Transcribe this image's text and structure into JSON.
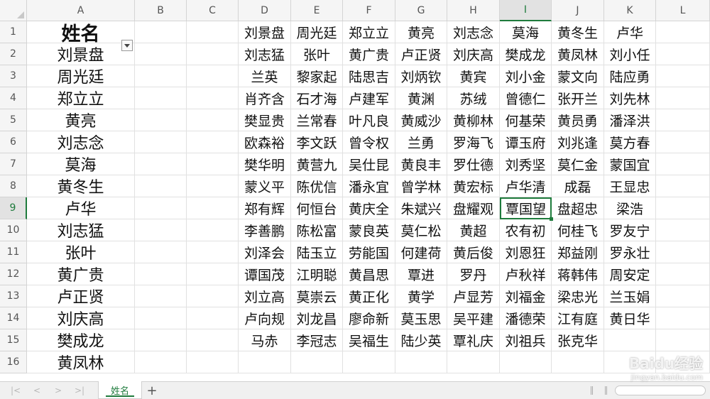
{
  "columns": [
    "A",
    "B",
    "C",
    "D",
    "E",
    "F",
    "G",
    "H",
    "I",
    "J",
    "K",
    "L"
  ],
  "rows": [
    "1",
    "2",
    "3",
    "4",
    "5",
    "6",
    "7",
    "8",
    "9",
    "10",
    "11",
    "12",
    "13",
    "14",
    "15",
    "16"
  ],
  "active_cell": "I9",
  "colA": [
    "姓名",
    "刘景盘",
    "周光廷",
    "郑立立",
    "黄亮",
    "刘志念",
    "莫海",
    "黄冬生",
    "卢华",
    "刘志猛",
    "张叶",
    "黄广贵",
    "卢正贤",
    "刘庆高",
    "樊成龙",
    "黄凤林"
  ],
  "grid": [
    [
      "刘景盘",
      "周光廷",
      "郑立立",
      "黄亮",
      "刘志念",
      "莫海",
      "黄冬生",
      "卢华"
    ],
    [
      "刘志猛",
      "张叶",
      "黄广贵",
      "卢正贤",
      "刘庆高",
      "樊成龙",
      "黄凤林",
      "刘小任"
    ],
    [
      "兰英",
      "黎家起",
      "陆思吉",
      "刘炳钦",
      "黄宾",
      "刘小金",
      "蒙文向",
      "陆应勇"
    ],
    [
      "肖齐含",
      "石才海",
      "卢建军",
      "黄渊",
      "苏绒",
      "曾德仁",
      "张开兰",
      "刘先林"
    ],
    [
      "樊显贵",
      "兰常春",
      "叶凡良",
      "黄威沙",
      "黄柳林",
      "何基荣",
      "黄员勇",
      "潘泽洪"
    ],
    [
      "欧森裕",
      "李文跃",
      "曾令权",
      "兰勇",
      "罗海飞",
      "谭玉府",
      "刘兆逢",
      "莫方春"
    ],
    [
      "樊华明",
      "黄营九",
      "吴仕昆",
      "黄良丰",
      "罗仕德",
      "刘秀坚",
      "莫仁金",
      "蒙国宜"
    ],
    [
      "蒙义平",
      "陈优信",
      "潘永宜",
      "曾学林",
      "黄宏标",
      "卢华清",
      "成磊",
      "王显忠"
    ],
    [
      "郑有辉",
      "何恒台",
      "黄庆全",
      "朱斌兴",
      "盘耀观",
      "覃国望",
      "盘超忠",
      "梁浩"
    ],
    [
      "李善鹏",
      "陈松富",
      "蒙良英",
      "莫仁松",
      "黄超",
      "农有初",
      "何桂飞",
      "罗友宁"
    ],
    [
      "刘泽会",
      "陆玉立",
      "劳能国",
      "何建荷",
      "黄后俊",
      "刘恩狂",
      "郑益刚",
      "罗永壮"
    ],
    [
      "谭国茂",
      "江明聪",
      "黄昌思",
      "覃进",
      "罗丹",
      "卢秋祥",
      "蒋韩伟",
      "周安定"
    ],
    [
      "刘立高",
      "莫崇云",
      "黄正化",
      "黄学",
      "卢显芳",
      "刘福金",
      "梁忠光",
      "兰玉娟"
    ],
    [
      "卢向规",
      "刘龙昌",
      "廖命新",
      "莫玉思",
      "吴平建",
      "潘德荣",
      "江有庭",
      "黄日华"
    ],
    [
      "马赤",
      "李冠志",
      "吴福生",
      "陆少英",
      "覃礼庆",
      "刘祖兵",
      "张克华",
      ""
    ],
    [
      "",
      "",
      "",
      "",
      "",
      "",
      "",
      ""
    ]
  ],
  "sheet_tab": "姓名",
  "add_sheet": "+",
  "nav": [
    "|<",
    "<",
    ">",
    ">|"
  ],
  "watermark": {
    "brand": "Baidu经验",
    "url": "jingyan.baidu.com"
  },
  "colors": {
    "accent": "#1e7b3c",
    "header_bg": "#f5f5f5",
    "gridline": "#e1e1e1"
  }
}
